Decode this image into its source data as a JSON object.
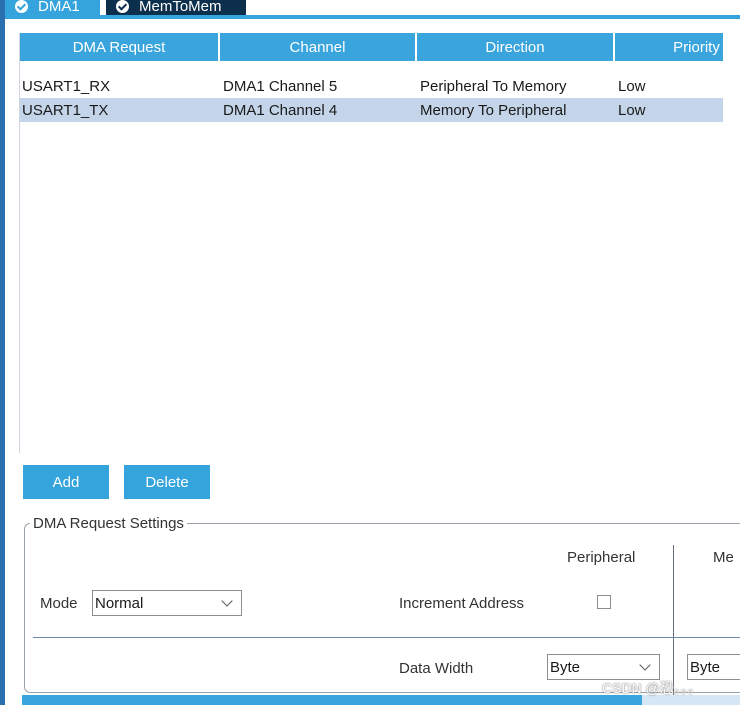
{
  "tabs": [
    {
      "label": "DMA1"
    },
    {
      "label": "MemToMem"
    }
  ],
  "table": {
    "headers": [
      "DMA Request",
      "Channel",
      "Direction",
      "Priority"
    ],
    "rows": [
      [
        "USART1_RX",
        "DMA1 Channel 5",
        "Peripheral To Memory",
        "Low"
      ],
      [
        "USART1_TX",
        "DMA1 Channel 4",
        "Memory To Peripheral",
        "Low"
      ]
    ],
    "selected_row": 1
  },
  "buttons": {
    "add": "Add",
    "delete": "Delete"
  },
  "settings": {
    "title": "DMA Request Settings",
    "col_peripheral": "Peripheral",
    "col_memory": "Memory",
    "mode_label": "Mode",
    "mode_value": "Normal",
    "increment_label": "Increment Address",
    "data_width_label": "Data Width",
    "peripheral_width": "Byte",
    "memory_width": "Byte"
  },
  "watermark": "CSDN @恐。。。",
  "colors": {
    "accent": "#35a4dc",
    "selected_row": "#c4d4e9",
    "dark_tab": "#0c2f4d"
  }
}
